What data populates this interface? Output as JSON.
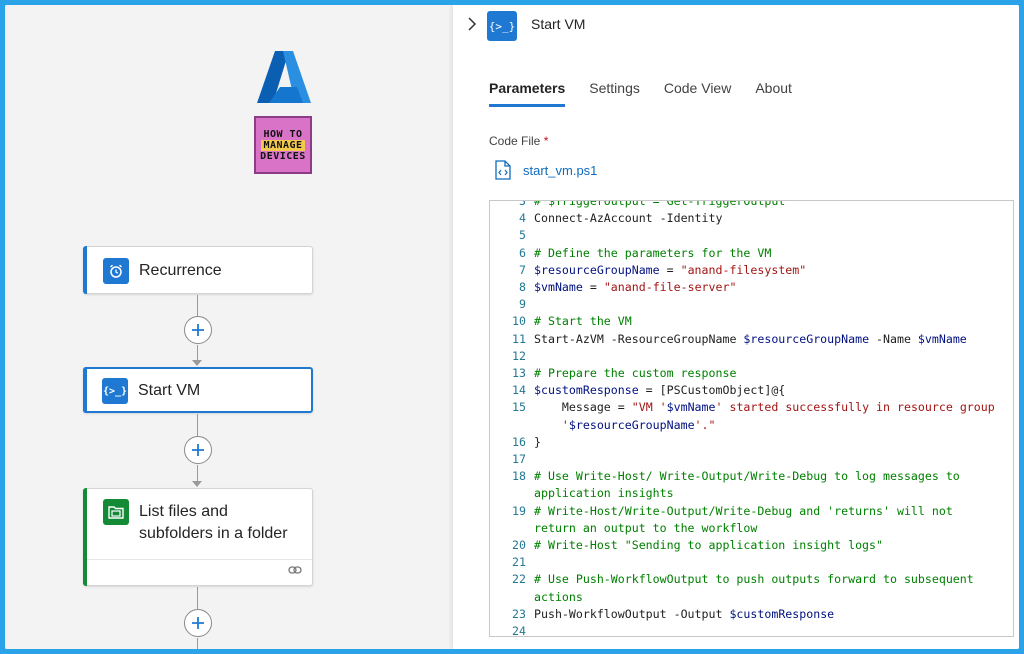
{
  "colors": {
    "accent": "#1f78d1",
    "frame": "#2aa3e8",
    "action_green": "#138a36"
  },
  "logos": {
    "htmd_lines": [
      "HOW TO",
      "MANAGE",
      "DEVICES"
    ]
  },
  "designer": {
    "steps": [
      {
        "label": "Recurrence",
        "icon": "alarm-clock-icon"
      },
      {
        "label": "Start VM",
        "icon": "code-brackets-icon"
      },
      {
        "label_line1": "List files and",
        "label_line2": "subfolders in a folder",
        "icon": "folder-icon"
      }
    ]
  },
  "panel": {
    "title": "Start VM",
    "tabs": [
      "Parameters",
      "Settings",
      "Code View",
      "About"
    ],
    "active_tab": "Parameters",
    "code_file_label": "Code File",
    "required_marker": "*",
    "file_name": "start_vm.ps1"
  },
  "editor": {
    "lines": [
      {
        "n": "3",
        "segs": [
          {
            "t": "# $TriggerOutput = Get-TriggerOutput",
            "c": "c-comment"
          }
        ]
      },
      {
        "n": "4",
        "segs": [
          {
            "t": "Connect-AzAccount -Identity",
            "c": "c-plain"
          }
        ]
      },
      {
        "n": "5",
        "segs": []
      },
      {
        "n": "6",
        "segs": [
          {
            "t": "# Define the parameters for the VM",
            "c": "c-comment"
          }
        ]
      },
      {
        "n": "7",
        "segs": [
          {
            "t": "$resourceGroupName",
            "c": "c-var"
          },
          {
            "t": " = ",
            "c": "c-plain"
          },
          {
            "t": "\"anand-filesystem\"",
            "c": "c-str"
          }
        ]
      },
      {
        "n": "8",
        "segs": [
          {
            "t": "$vmName",
            "c": "c-var"
          },
          {
            "t": " = ",
            "c": "c-plain"
          },
          {
            "t": "\"anand-file-server\"",
            "c": "c-str"
          }
        ]
      },
      {
        "n": "9",
        "segs": []
      },
      {
        "n": "10",
        "segs": [
          {
            "t": "# Start the VM",
            "c": "c-comment"
          }
        ]
      },
      {
        "n": "11",
        "segs": [
          {
            "t": "Start-AzVM -ResourceGroupName ",
            "c": "c-plain"
          },
          {
            "t": "$resourceGroupName",
            "c": "c-var"
          },
          {
            "t": " -Name ",
            "c": "c-plain"
          },
          {
            "t": "$vmName",
            "c": "c-var"
          }
        ]
      },
      {
        "n": "12",
        "segs": []
      },
      {
        "n": "13",
        "segs": [
          {
            "t": "# Prepare the custom response",
            "c": "c-comment"
          }
        ]
      },
      {
        "n": "14",
        "segs": [
          {
            "t": "$customResponse",
            "c": "c-var"
          },
          {
            "t": " = [PSCustomObject]@{",
            "c": "c-plain"
          }
        ]
      },
      {
        "n": "15",
        "segs": [
          {
            "t": "    Message = ",
            "c": "c-plain"
          },
          {
            "t": "\"VM '",
            "c": "c-str"
          },
          {
            "t": "$vmName",
            "c": "c-var"
          },
          {
            "t": "' started successfully in resource group",
            "c": "c-str"
          }
        ]
      },
      {
        "n": "",
        "segs": [
          {
            "t": "    '",
            "c": "c-str"
          },
          {
            "t": "$resourceGroupName",
            "c": "c-var"
          },
          {
            "t": "'.\"",
            "c": "c-str"
          }
        ]
      },
      {
        "n": "16",
        "segs": [
          {
            "t": "}",
            "c": "c-plain"
          }
        ]
      },
      {
        "n": "17",
        "segs": []
      },
      {
        "n": "18",
        "segs": [
          {
            "t": "# Use Write-Host/ Write-Output/Write-Debug to log messages to",
            "c": "c-comment"
          }
        ]
      },
      {
        "n": "",
        "segs": [
          {
            "t": "application insights",
            "c": "c-comment"
          }
        ]
      },
      {
        "n": "19",
        "segs": [
          {
            "t": "# Write-Host/Write-Output/Write-Debug and 'returns' will not",
            "c": "c-comment"
          }
        ]
      },
      {
        "n": "",
        "segs": [
          {
            "t": "return an output to the workflow",
            "c": "c-comment"
          }
        ]
      },
      {
        "n": "20",
        "segs": [
          {
            "t": "# Write-Host \"Sending to application insight logs\"",
            "c": "c-comment"
          }
        ]
      },
      {
        "n": "21",
        "segs": []
      },
      {
        "n": "22",
        "segs": [
          {
            "t": "# Use Push-WorkflowOutput to push outputs forward to subsequent",
            "c": "c-comment"
          }
        ]
      },
      {
        "n": "",
        "segs": [
          {
            "t": "actions",
            "c": "c-comment"
          }
        ]
      },
      {
        "n": "23",
        "segs": [
          {
            "t": "Push-WorkflowOutput -Output ",
            "c": "c-plain"
          },
          {
            "t": "$customResponse",
            "c": "c-var"
          }
        ]
      },
      {
        "n": "24",
        "segs": []
      }
    ]
  }
}
